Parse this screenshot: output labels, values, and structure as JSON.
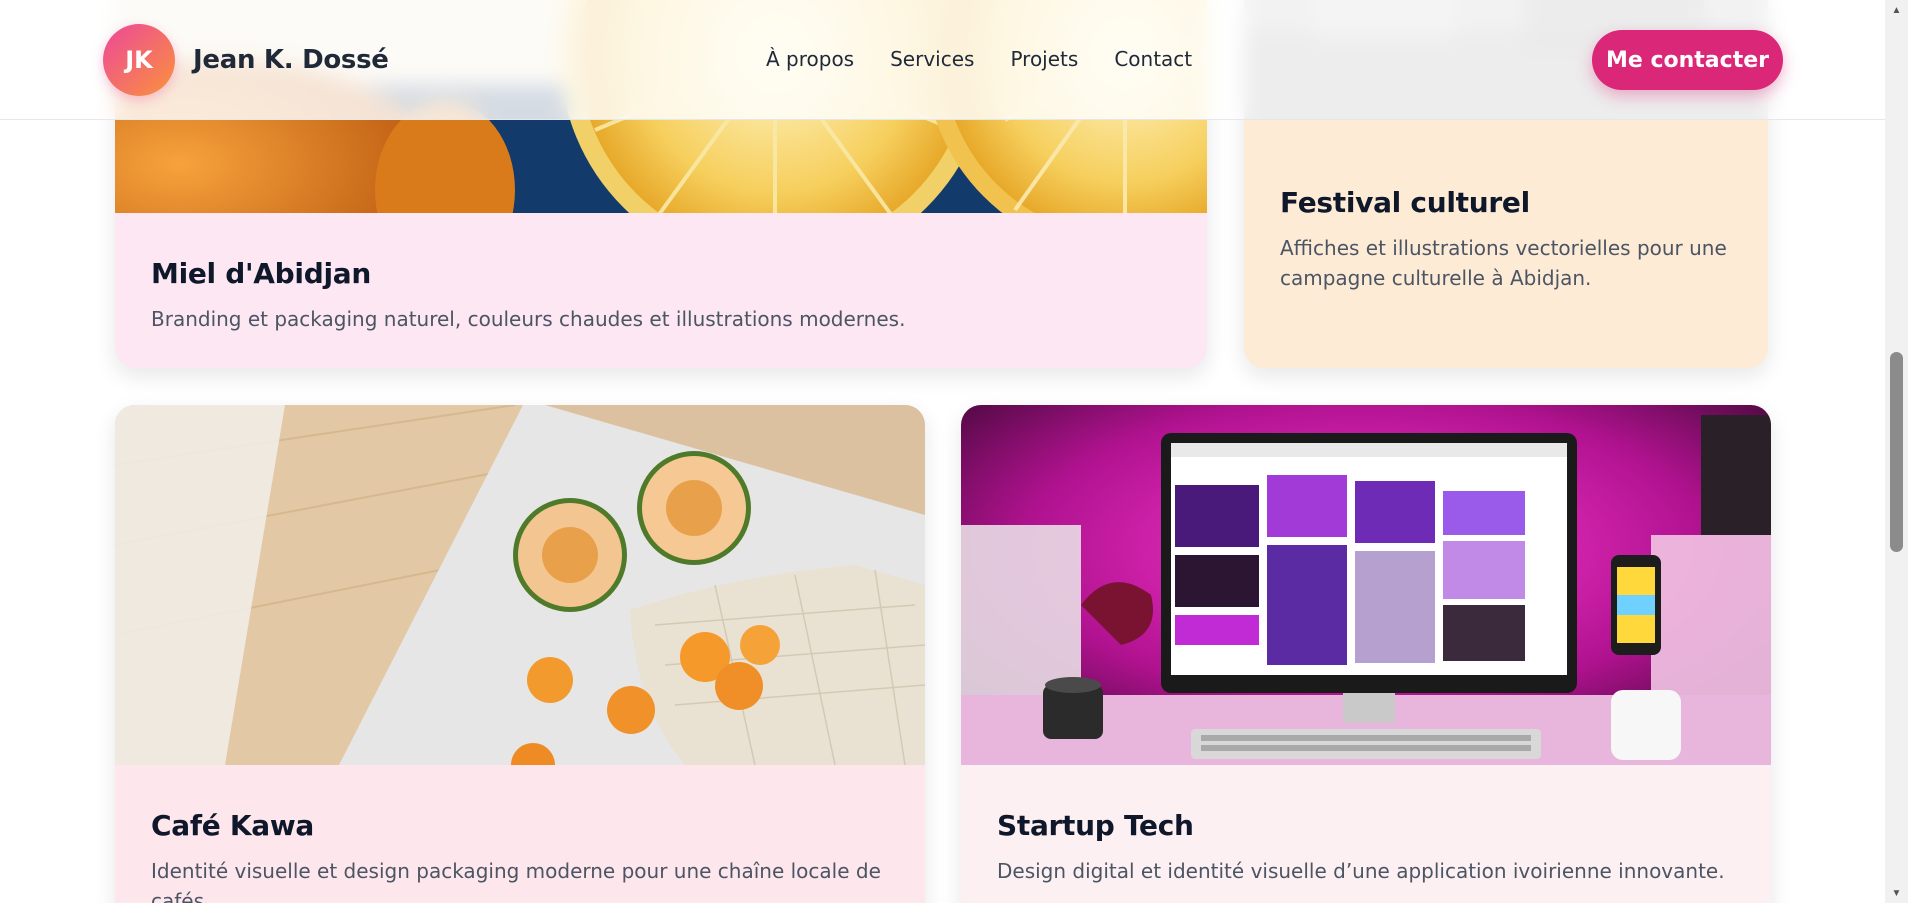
{
  "header": {
    "avatar_initials": "JK",
    "name": "Jean K. Dossé",
    "nav": [
      "À propos",
      "Services",
      "Projets",
      "Contact"
    ],
    "cta_label": "Me contacter"
  },
  "projects": [
    {
      "title": "Miel d'Abidjan",
      "description": "Branding et packaging naturel, couleurs chaudes et illustrations modernes.",
      "image": "citrus-halves-photo",
      "card_color": "#fce7f3"
    },
    {
      "title": "Festival culturel",
      "description": "Affiches et illustrations vectorielles pour une campagne culturelle à Abidjan.",
      "image": "blurred-gray-photo",
      "card_color": "#fdebd6"
    },
    {
      "title": "Café Kawa",
      "description": "Identité visuelle et design packaging moderne pour une chaîne locale de cafés.",
      "image": "melon-apricots-mesh-bag-photo",
      "card_color": "#fde6ec"
    },
    {
      "title": "Startup Tech",
      "description": "Design digital et identité visuelle d’une application ivoirienne innovante.",
      "image": "pink-lit-desktop-computer-photo",
      "card_color": "#fdf0f2"
    }
  ],
  "colors": {
    "accent": "#db2777",
    "avatar_gradient": [
      "#ec4899",
      "#fb923c"
    ],
    "text_dark": "#0f172a",
    "text_muted": "#4b5563"
  }
}
